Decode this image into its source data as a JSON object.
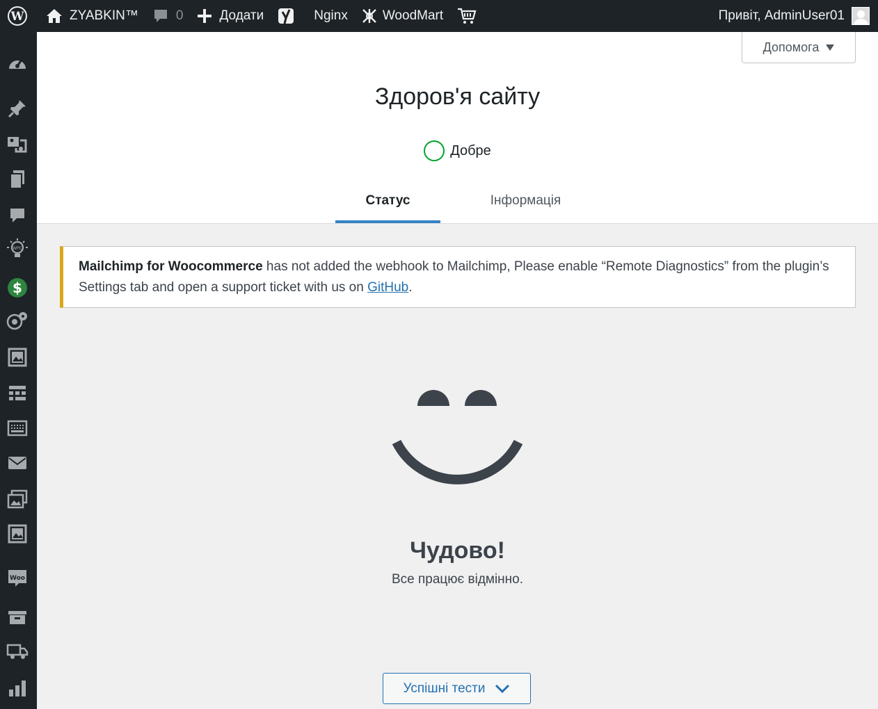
{
  "adminbar": {
    "site_name": "ZYABKIN™",
    "comments_count": "0",
    "add_new": "Додати",
    "nginx": "Nginx",
    "woodmart": "WoodMart",
    "greeting": "Привіт, AdminUser01"
  },
  "help": {
    "label": "Допомога"
  },
  "page": {
    "title": "Здоров'я сайту",
    "status": "Добре"
  },
  "tabs": [
    {
      "label": "Статус"
    },
    {
      "label": "Інформація"
    }
  ],
  "notice": {
    "plugin": "Mailchimp for Woocommerce",
    "message": " has not added the webhook to Mailchimp, Please enable “Remote Diagnostics” from the plugin’s Settings tab and open a support ticket with us on ",
    "link": "GitHub",
    "end": "."
  },
  "result": {
    "title": "Чудово!",
    "subtitle": "Все працює відмінно."
  },
  "passed_tests": {
    "label": "Успішні тести"
  },
  "colors": {
    "good": "#00a32a",
    "accent": "#3582c4",
    "warning": "#dba617",
    "link": "#2271b1"
  }
}
